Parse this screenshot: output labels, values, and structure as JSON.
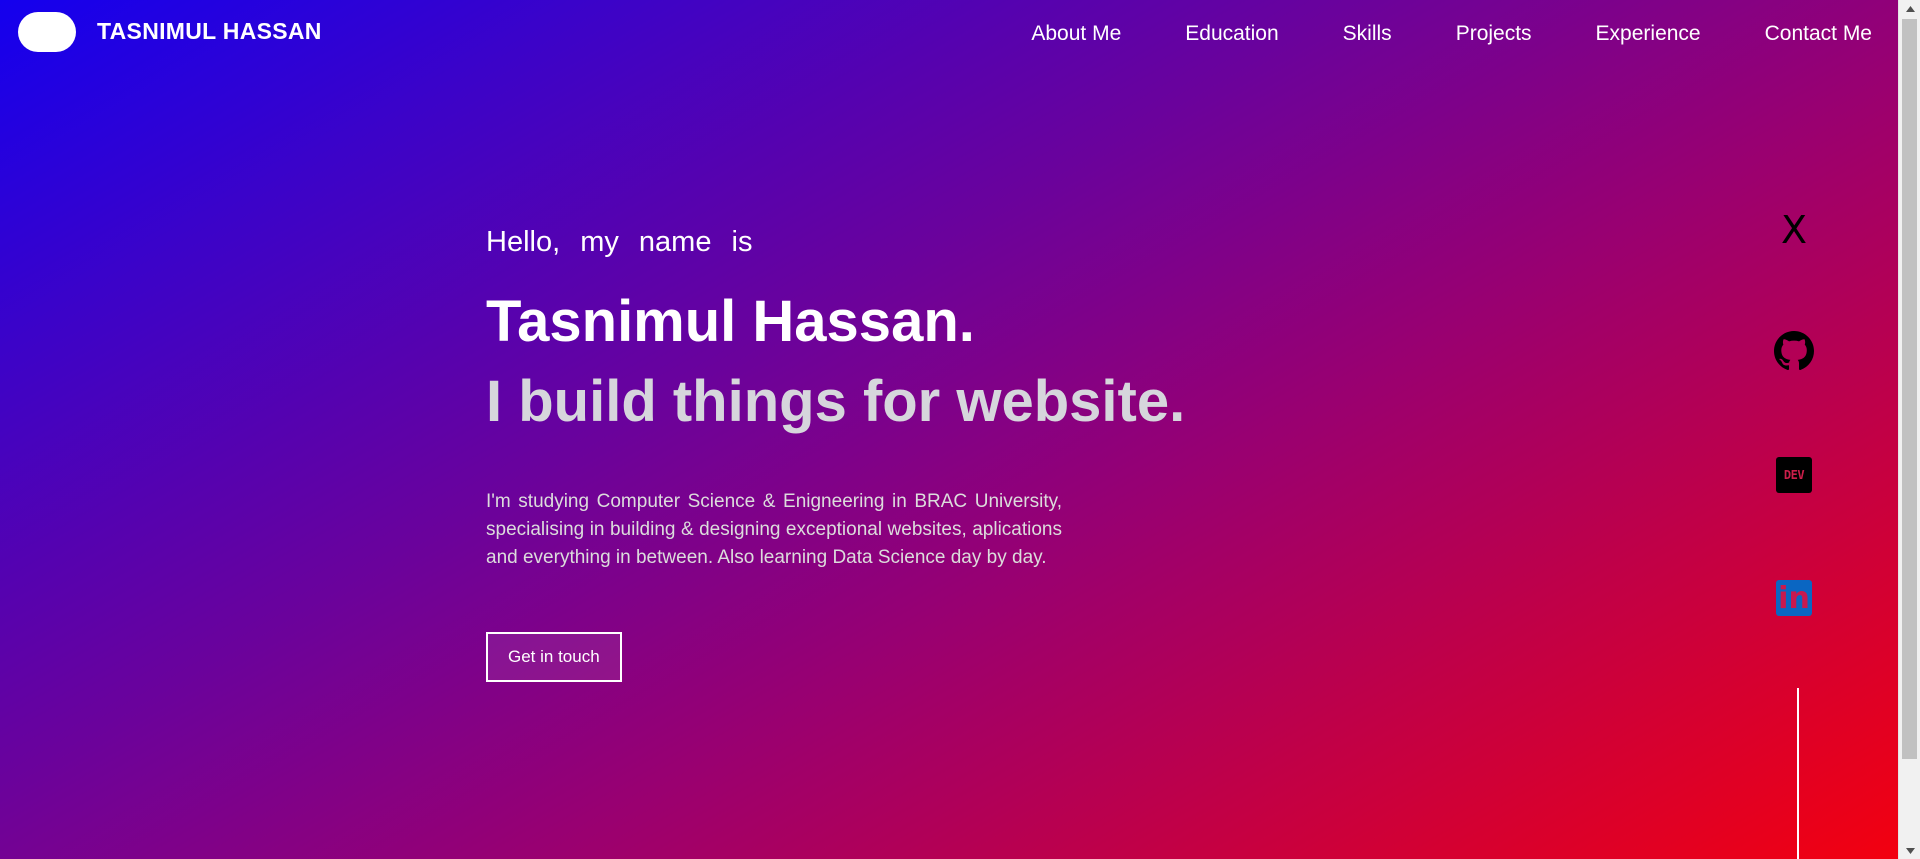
{
  "header": {
    "brand": "TASNIMUL HASSAN",
    "nav": [
      "About Me",
      "Education",
      "Skills",
      "Projects",
      "Experience",
      "Contact Me"
    ]
  },
  "hero": {
    "greeting": "Hello, my name is",
    "name": "Tasnimul Hassan.",
    "tagline": "I build things for website.",
    "bio": "I'm studying Computer Science & Enigneering in BRAC University, specialising in building & designing exceptional websites, aplications and everything in between. Also learning Data Science day by day.",
    "cta_label": "Get in touch"
  },
  "social": {
    "x_label": "X",
    "dev_label": "DEV",
    "linkedin_label": "in",
    "icons": [
      "x-icon",
      "github-icon",
      "dev-icon",
      "linkedin-icon"
    ]
  },
  "colors": {
    "gradient_start": "#1400ee",
    "gradient_end": "#f3000f",
    "linkedin_blue": "#0a66c2",
    "dev_black": "#000000"
  }
}
